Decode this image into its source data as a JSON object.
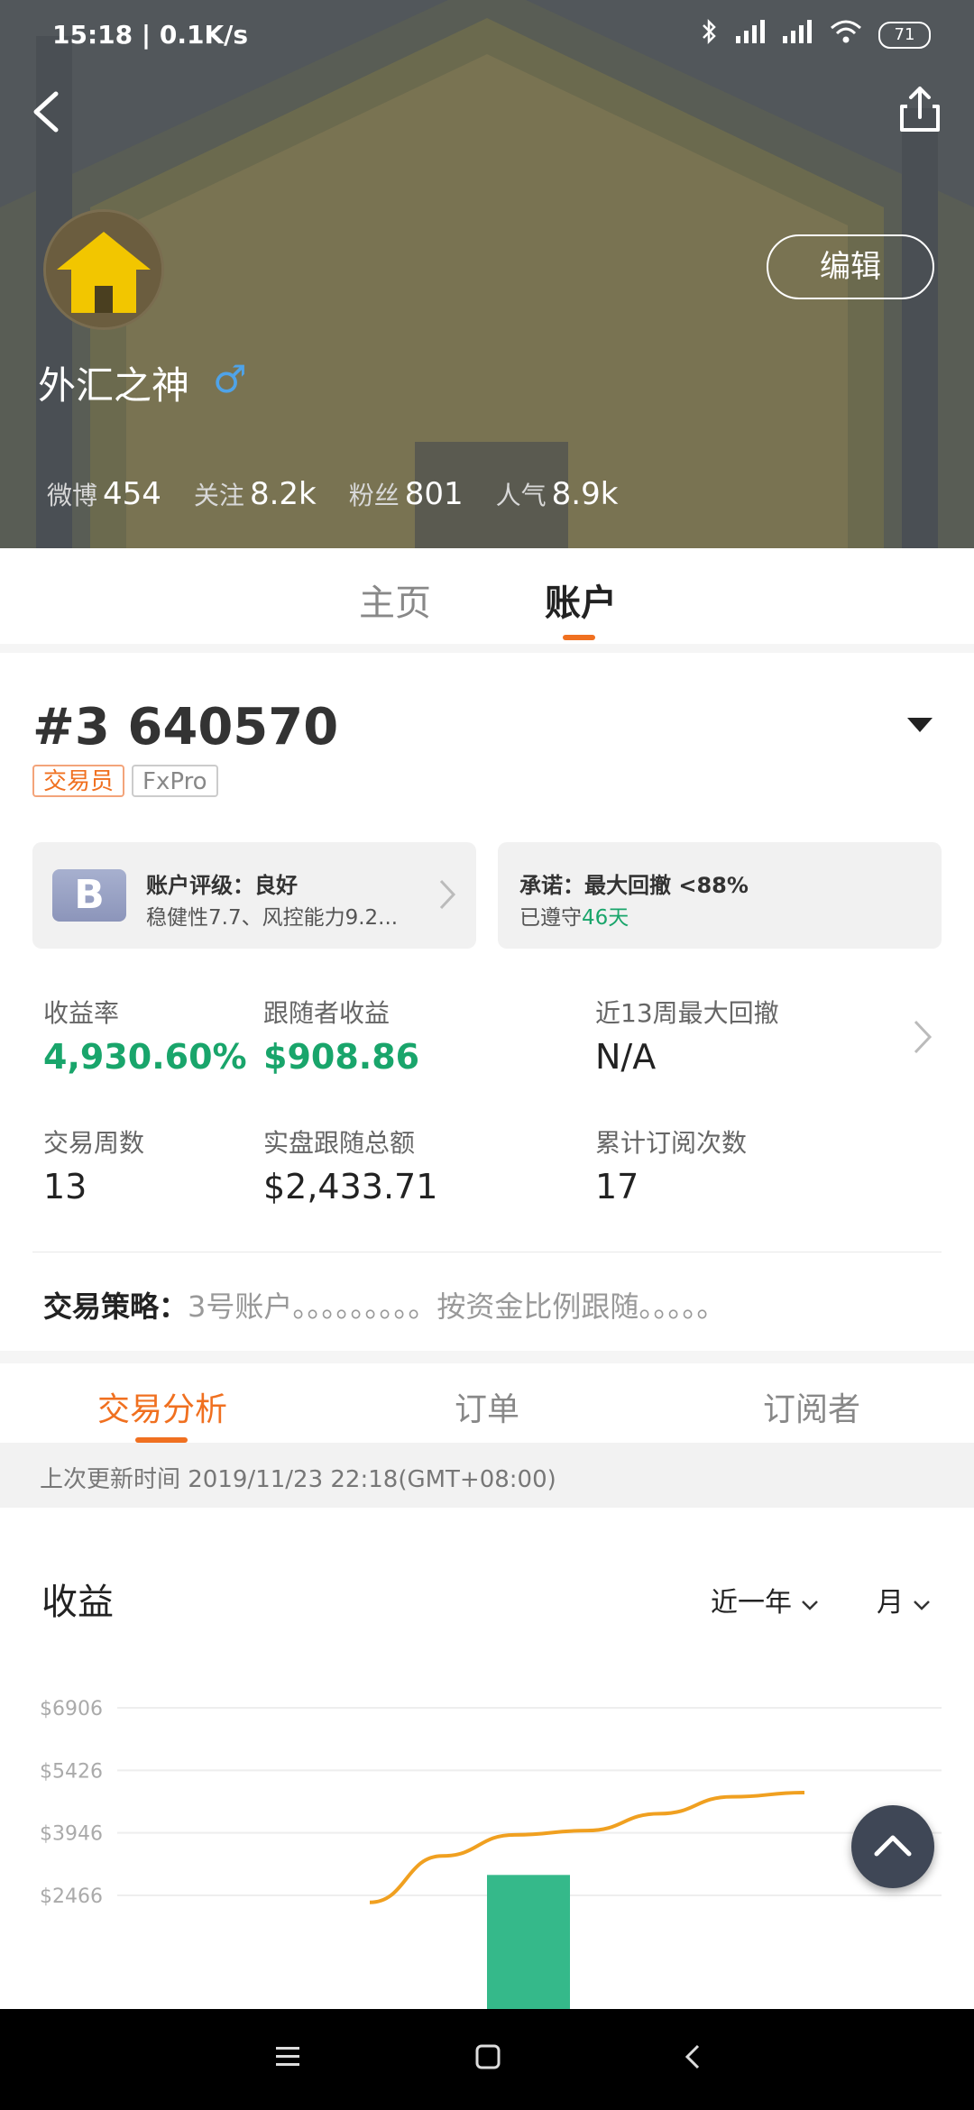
{
  "status_bar": {
    "time": "15:18 | 0.1K/s",
    "battery": "71"
  },
  "profile": {
    "name": "外汇之神",
    "gender_symbol": "♂",
    "edit_label": "编辑",
    "stats": [
      {
        "label": "微博",
        "value": "454"
      },
      {
        "label": "关注",
        "value": "8.2k"
      },
      {
        "label": "粉丝",
        "value": "801"
      },
      {
        "label": "人气",
        "value": "8.9k"
      }
    ]
  },
  "main_tabs": [
    {
      "label": "主页",
      "active": false
    },
    {
      "label": "账户",
      "active": true
    }
  ],
  "account": {
    "id": "#3 640570",
    "tag_trader": "交易员",
    "tag_broker": "FxPro",
    "grade_letter": "B",
    "rating_title": "账户评级：良好",
    "rating_detail": "稳健性7.7、风控能力9.2...",
    "promise_title": "承诺：最大回撤 <88%",
    "promise_prefix": "已遵守",
    "promise_days": "46天",
    "metrics": [
      {
        "label": "收益率",
        "value": "4,930.60%"
      },
      {
        "label": "跟随者收益",
        "value": "$908.86"
      },
      {
        "label": "近13周最大回撤",
        "value": "N/A"
      },
      {
        "label": "交易周数",
        "value": "13"
      },
      {
        "label": "实盘跟随总额",
        "value": "$2,433.71"
      },
      {
        "label": "累计订阅次数",
        "value": "17"
      }
    ],
    "strategy_label": "交易策略：",
    "strategy_text": "3号账户。。。。。。。。。按资金比例跟随。。。。。"
  },
  "sub_tabs": [
    {
      "label": "交易分析",
      "active": true
    },
    {
      "label": "订单",
      "active": false
    },
    {
      "label": "订阅者",
      "active": false
    }
  ],
  "last_update": "上次更新时间 2019/11/23 22:18(GMT+08:00)",
  "earnings": {
    "title": "收益",
    "period_select": "近一年",
    "unit_select": "月"
  },
  "chart_data": {
    "type": "bar",
    "title": "",
    "yticks": [
      "$6906",
      "$5426",
      "$3946",
      "$2466"
    ],
    "ylim": [
      2466,
      6906
    ],
    "bars": [
      {
        "y_top": 2950,
        "color": "#35b98a"
      }
    ],
    "line": {
      "color": "#f0a020",
      "points": [
        2300,
        3400,
        3900,
        4000,
        4400,
        4800,
        4900
      ]
    }
  }
}
